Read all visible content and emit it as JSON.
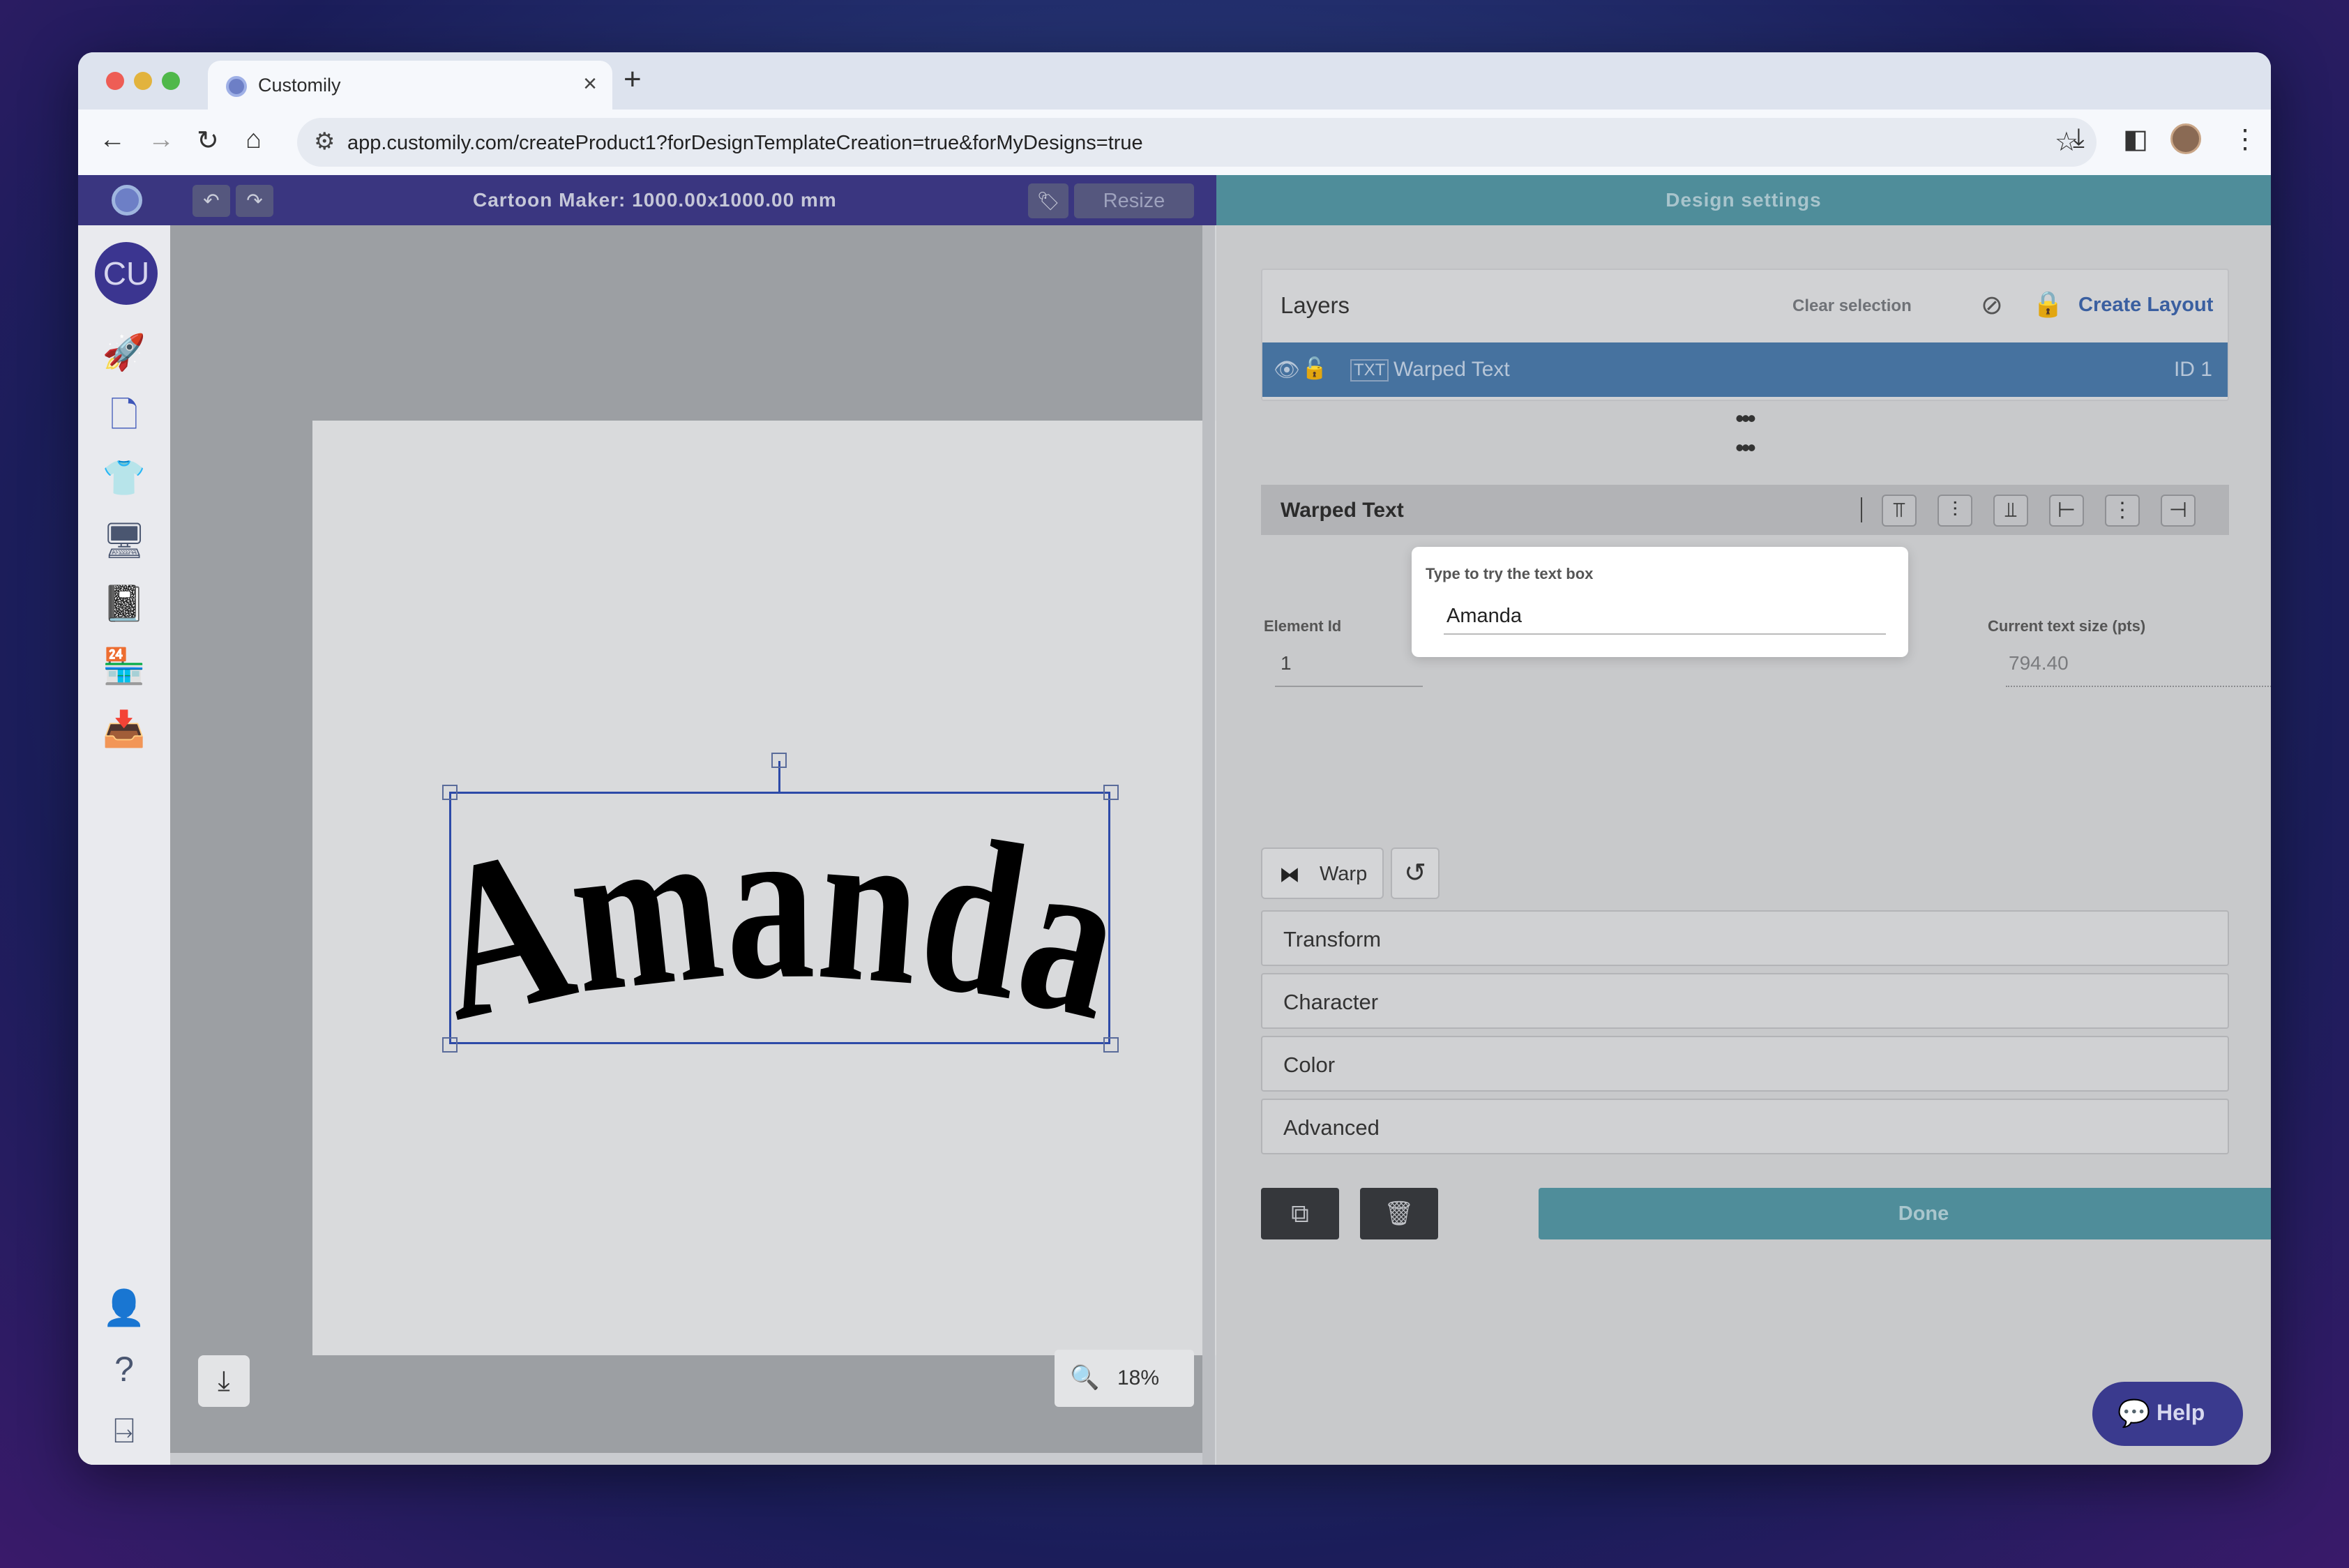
{
  "browser": {
    "tab_title": "Customily",
    "tab_close": "×",
    "new_tab": "+",
    "url": "app.customily.com/createProduct1?forDesignTemplateCreation=true&forMyDesigns=true"
  },
  "header": {
    "title": "Cartoon Maker: 1000.00x1000.00 mm",
    "resize_label": "Resize",
    "settings_label": "Design settings"
  },
  "sidebar": {
    "avatar_initials": "CU",
    "icons": [
      "rocket-icon",
      "document-icon",
      "tshirt-icon",
      "monitor-icon",
      "book-icon",
      "store-icon",
      "inbox-icon",
      "user-settings-icon",
      "help-circle-icon",
      "exit-icon"
    ]
  },
  "canvas": {
    "text": "Amanda",
    "zoom": "18%"
  },
  "layers": {
    "title": "Layers",
    "clear_selection": "Clear selection",
    "create_layout": "Create Layout",
    "items": [
      {
        "type": "TXT",
        "name": "Warped Text",
        "id": "ID 1"
      }
    ]
  },
  "element": {
    "title": "Warped Text",
    "element_id_label": "Element Id",
    "element_id_value": "1",
    "try_label": "Type to try the text box",
    "try_value": "Amanda",
    "size_label": "Current text size (pts)",
    "size_value": "794.40",
    "warp_label": "Warp",
    "sections": [
      "Transform",
      "Character",
      "Color",
      "Advanced"
    ],
    "done_label": "Done"
  },
  "help": {
    "label": "Help"
  }
}
